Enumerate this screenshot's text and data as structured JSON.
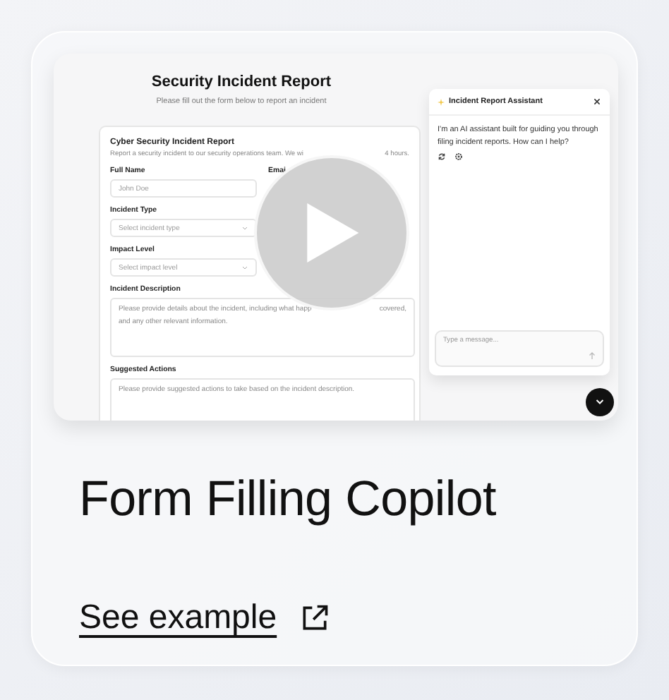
{
  "preview": {
    "form_page": {
      "title": "Security Incident Report",
      "subtitle": "Please fill out the form below to report an incident",
      "form": {
        "title": "Cyber Security Incident Report",
        "description_parts": [
          "Report a security incident to our security operations team. We wi",
          "4 hours."
        ],
        "fields": [
          {
            "kind": "text",
            "label": "Full Name",
            "placeholder_parts": [
              "John Doe"
            ]
          },
          {
            "kind": "label",
            "label": "Emai"
          },
          {
            "kind": "select",
            "label": "Incident Type",
            "placeholder_parts": [
              "Select incident type"
            ]
          },
          {
            "kind": "select",
            "label": "Impact Level",
            "placeholder_parts": [
              "Select impact level"
            ]
          },
          {
            "kind": "textarea",
            "label": "Incident Description",
            "placeholder_parts": [
              "Please provide details about the incident, including what happ",
              "covered,",
              "and any other relevant information."
            ]
          },
          {
            "kind": "textarea",
            "label": "Suggested Actions",
            "placeholder_parts": [
              "Please provide suggested actions to take based on the incident description."
            ]
          }
        ]
      }
    },
    "assistant": {
      "title": "Incident Report Assistant",
      "message": "I'm an AI assistant built for guiding you through filing incident reports. How can I help?",
      "input": {
        "placeholder": "Type a message..."
      }
    }
  },
  "title": "Form Filling Copilot",
  "link": "See example"
}
